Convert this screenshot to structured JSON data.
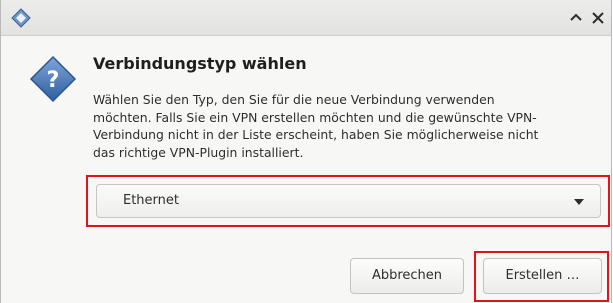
{
  "titlebar": {
    "app_icon": "vpn-diamond-icon",
    "minimize_icon": "chevron-up-icon",
    "close_icon": "close-icon"
  },
  "dialog": {
    "icon": "question-icon",
    "heading": "Verbindungstyp wählen",
    "body_lines": [
      "Wählen Sie den Typ, den Sie für die neue Verbindung verwenden",
      "möchten. Falls Sie ein VPN erstellen möchten und die gewünschte VPN-",
      "Verbindung nicht in der Liste erscheint, haben Sie möglicherweise nicht",
      "das richtige VPN-Plugin installiert."
    ],
    "connection_type": {
      "selected": "Ethernet",
      "arrow_icon": "dropdown-arrow-icon"
    },
    "buttons": {
      "cancel": "Abbrechen",
      "create": "Erstellen …"
    }
  },
  "colors": {
    "highlight": "#e0141b",
    "icon_blue": "#3d6fb6",
    "window_bg": "#f7f7f6"
  }
}
